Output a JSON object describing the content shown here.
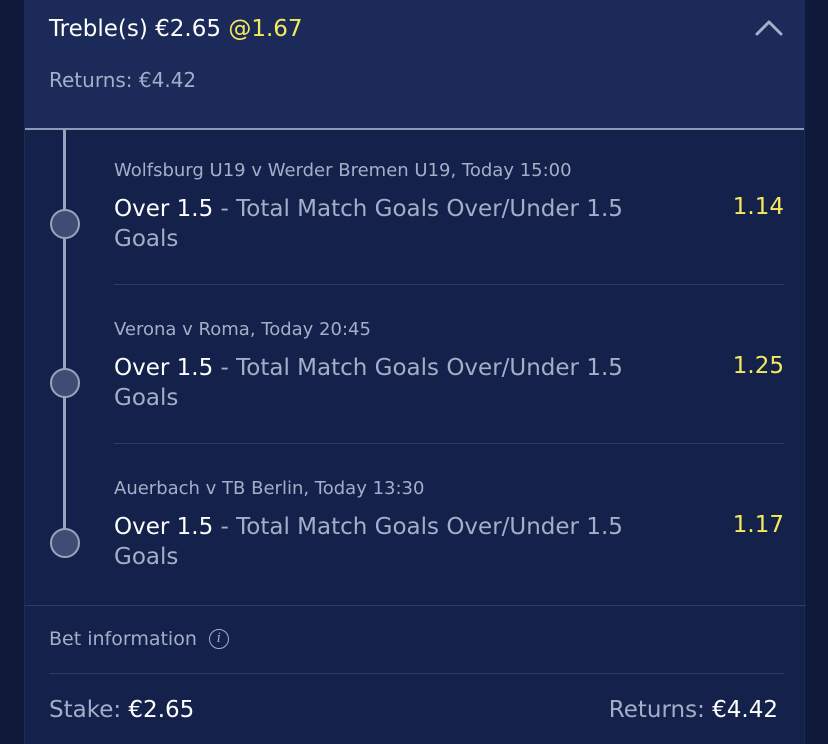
{
  "header": {
    "title_prefix": "Treble(s) €2.65",
    "title_odds": "@1.67",
    "returns": "Returns: €4.42",
    "collapse_icon": "chevron-up-icon"
  },
  "legs": [
    {
      "event": "Wolfsburg U19 v Werder Bremen U19, Today 15:00",
      "selection": "Over 1.5",
      "market": " - Total Match Goals Over/Under 1.5 Goals",
      "odds": "1.14"
    },
    {
      "event": "Verona v Roma, Today 20:45",
      "selection": "Over 1.5",
      "market": " - Total Match Goals Over/Under 1.5 Goals",
      "odds": "1.25"
    },
    {
      "event": "Auerbach v TB Berlin, Today 13:30",
      "selection": "Over 1.5",
      "market": " - Total Match Goals Over/Under 1.5 Goals",
      "odds": "1.17"
    }
  ],
  "bet_info": {
    "label": "Bet information",
    "icon": "info-icon",
    "icon_glyph": "i"
  },
  "footer": {
    "stake_label": "Stake: ",
    "stake_value": "€2.65",
    "returns_label": "Returns: ",
    "returns_value": "€4.42"
  },
  "colors": {
    "background": "#0f1a3a",
    "card": "#14214a",
    "header": "#1b2a58",
    "odds_yellow": "#f5ea5b",
    "muted_text": "#a4aec9"
  }
}
